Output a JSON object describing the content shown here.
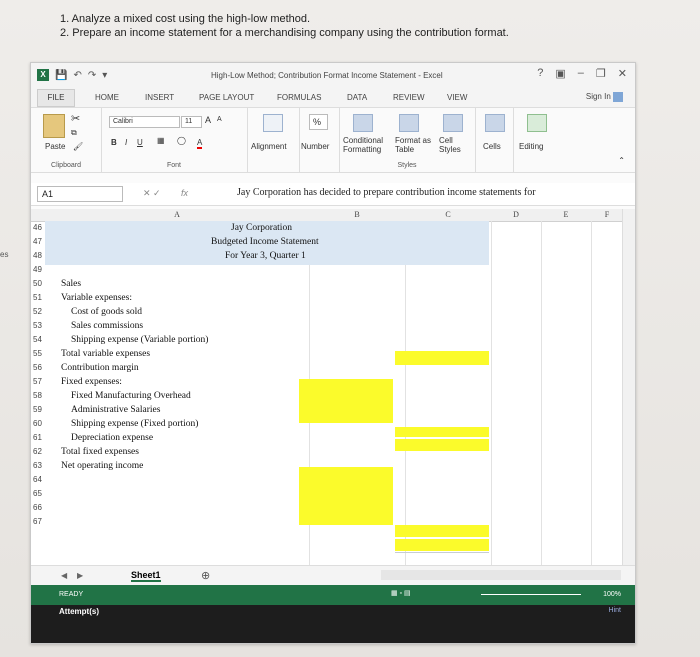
{
  "instructions": [
    "1. Analyze a mixed cost using the high-low method.",
    "2. Prepare an income statement for a merchandising company using the contribution format."
  ],
  "side_cut_text": "es",
  "window": {
    "title": "High-Low Method; Contribution Format Income Statement - Excel",
    "help": "?",
    "sign_in": "Sign In"
  },
  "tabs": [
    "FILE",
    "HOME",
    "INSERT",
    "PAGE LAYOUT",
    "FORMULAS",
    "DATA",
    "REVIEW",
    "VIEW"
  ],
  "ribbon": {
    "paste": "Paste",
    "clipboard": "Clipboard",
    "font_name": "Calibri",
    "font_size": "11",
    "grow": "A",
    "shrink": "A",
    "bold": "B",
    "italic": "I",
    "underline": "U",
    "font_color": "A",
    "font_group": "Font",
    "alignment": "Alignment",
    "number": "Number",
    "percent": "%",
    "conditional": "Conditional",
    "formatting": "Formatting",
    "format_as": "Format as",
    "table": "Table",
    "cell": "Cell",
    "styles_btn": "Styles",
    "styles_group": "Styles",
    "cells": "Cells",
    "editing": "Editing"
  },
  "formula_bar": {
    "name_box": "A1",
    "fx": "fx",
    "content": "Jay Corporation  has decided to prepare contribution income statements for"
  },
  "columns": [
    "A",
    "B",
    "C",
    "D",
    "E",
    "F"
  ],
  "rows": [
    {
      "num": "46",
      "text": "Jay Corporation"
    },
    {
      "num": "47",
      "text": "Budgeted Income Statement"
    },
    {
      "num": "48",
      "text": "For Year 3, Quarter 1"
    },
    {
      "num": "49",
      "text": ""
    },
    {
      "num": "50",
      "text": "Sales"
    },
    {
      "num": "51",
      "text": "Variable expenses:"
    },
    {
      "num": "52",
      "text": "Cost of goods sold"
    },
    {
      "num": "53",
      "text": "Sales commissions"
    },
    {
      "num": "54",
      "text": "Shipping expense (Variable portion)"
    },
    {
      "num": "55",
      "text": "Total variable expenses"
    },
    {
      "num": "56",
      "text": "Contribution margin"
    },
    {
      "num": "57",
      "text": "Fixed expenses:"
    },
    {
      "num": "58",
      "text": "Fixed Manufacturing Overhead"
    },
    {
      "num": "59",
      "text": "Administrative Salaries"
    },
    {
      "num": "60",
      "text": "Shipping expense (Fixed portion)"
    },
    {
      "num": "61",
      "text": "Depreciation expense"
    },
    {
      "num": "62",
      "text": "Total fixed expenses"
    },
    {
      "num": "63",
      "text": "Net operating income"
    },
    {
      "num": "64",
      "text": ""
    },
    {
      "num": "65",
      "text": ""
    },
    {
      "num": "66",
      "text": ""
    },
    {
      "num": "67",
      "text": ""
    }
  ],
  "sheet_tab": "Sheet1",
  "status": {
    "ready": "READY",
    "attempt": "Attempt(s)",
    "zoom": "100%",
    "hint": "Hint"
  },
  "colors": {
    "excel_green": "#217346",
    "input_yellow": "#fbfb2b",
    "header_blue": "#dbe7f3"
  }
}
